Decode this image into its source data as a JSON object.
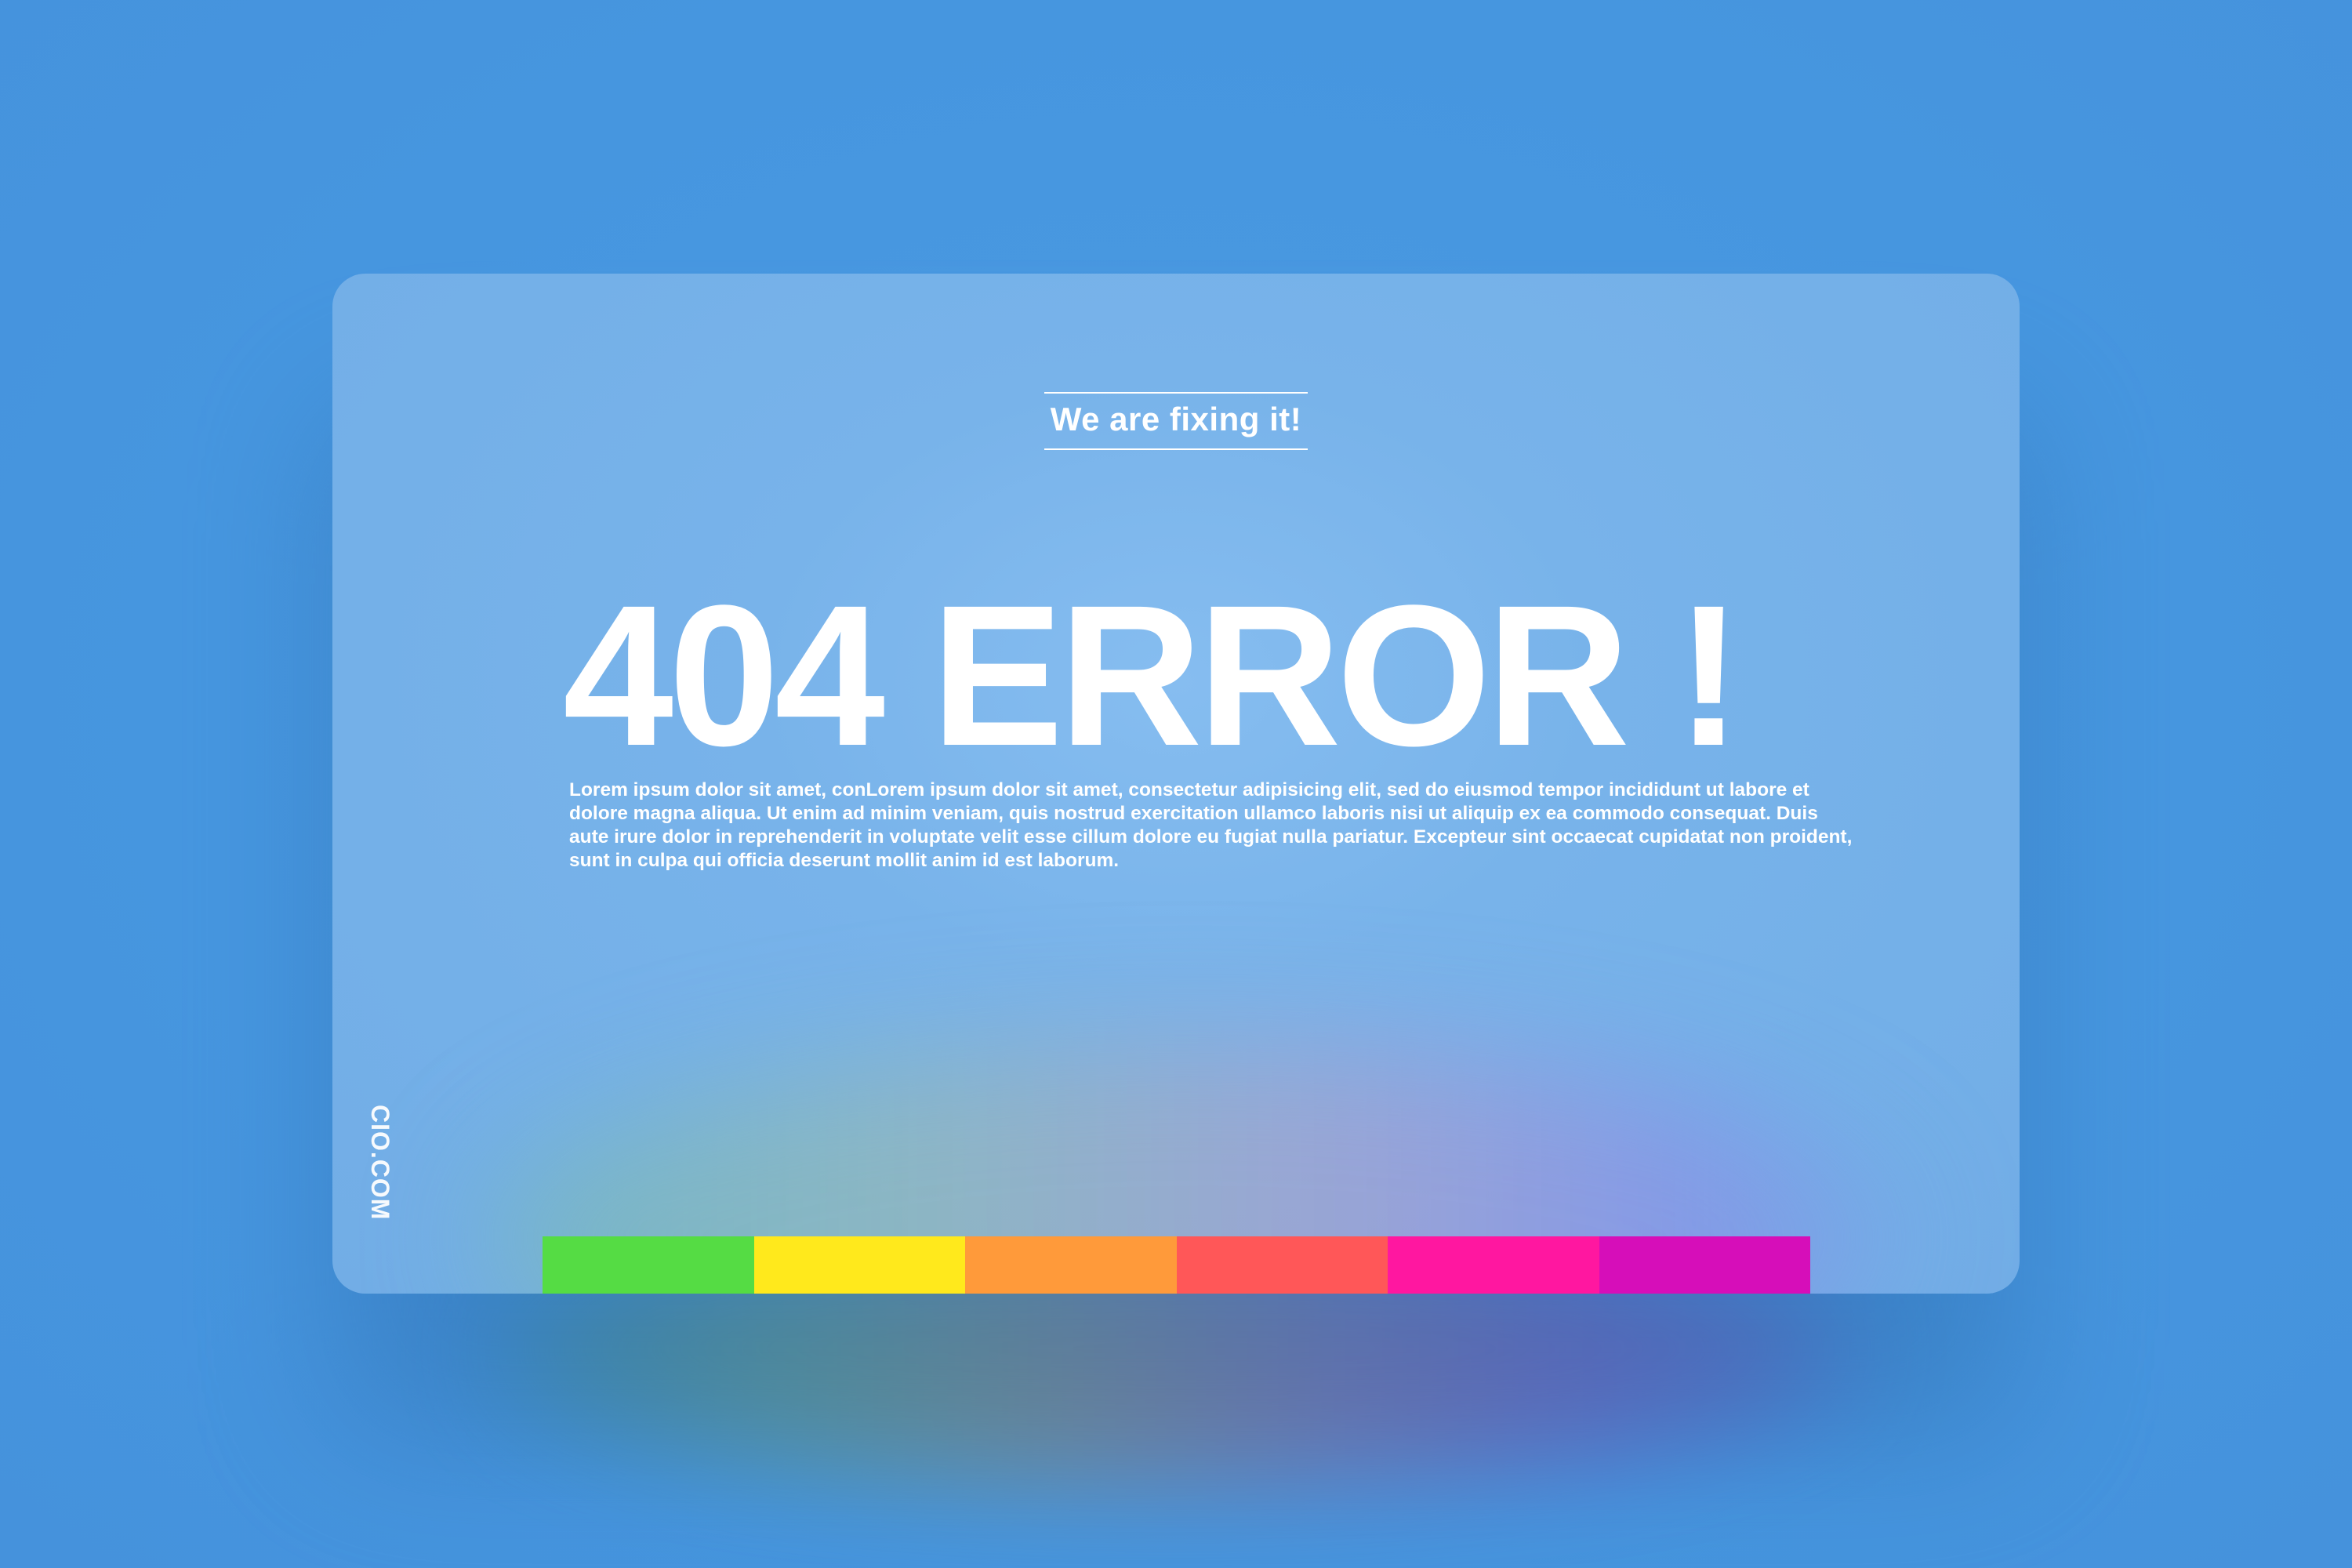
{
  "card": {
    "subtitle": "We are fixing it!",
    "headline": "404 ERROR !",
    "paragraph": "Lorem ipsum dolor sit amet, conLorem ipsum dolor sit amet, consectetur adipisicing elit, sed do eiusmod tempor incididunt ut labore et dolore magna aliqua. Ut enim ad minim veniam, quis nostrud exercitation ullamco laboris nisi ut aliquip ex ea commodo consequat. Duis aute irure dolor in reprehenderit in voluptate velit esse cillum dolore eu fugiat nulla pariatur. Excepteur sint occaecat cupidatat non proident, sunt in culpa qui officia deserunt mollit anim id est laborum.",
    "brand": "CIO.COM"
  },
  "colors": {
    "background": "#4797e0",
    "card": "#78b3ea",
    "text": "#ffffff",
    "swatches": [
      "#55dc44",
      "#ffe91c",
      "#ff9a3a",
      "#ff5758",
      "#ff17a0",
      "#d60eb9"
    ]
  }
}
